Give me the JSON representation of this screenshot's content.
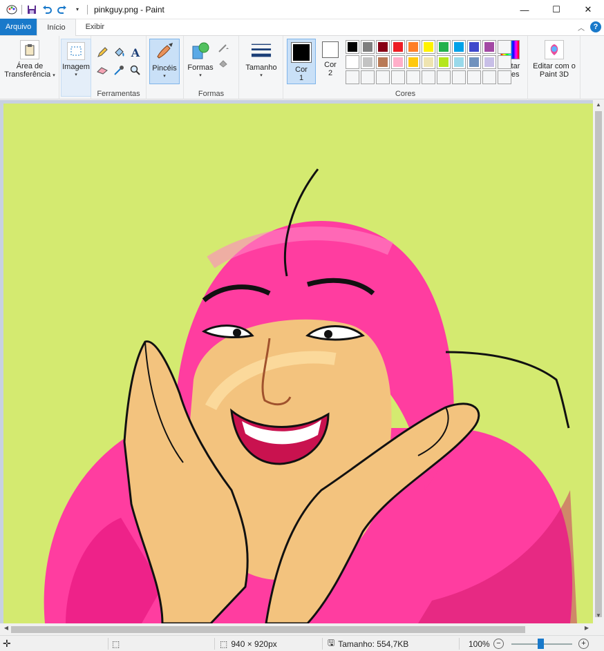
{
  "window": {
    "title": "pinkguy.png - Paint",
    "minimize": "—",
    "maximize": "☐",
    "close": "✕"
  },
  "tabs": [
    {
      "label": "Arquivo"
    },
    {
      "label": "Início"
    },
    {
      "label": "Exibir"
    }
  ],
  "ribbon": {
    "clipboard_label": "Área de Transferência",
    "image_label": "Imagem",
    "tools_group": "Ferramentas",
    "brushes_label": "Pincéis",
    "shapes_label": "Formas",
    "shapes_group": "Formas",
    "size_label": "Tamanho",
    "color1_label": "Cor 1",
    "color2_label": "Cor 2",
    "colors_group": "Cores",
    "edit_colors_label": "Editar cores",
    "paint3d_label": "Editar com o Paint 3D"
  },
  "palette": {
    "row1": [
      "#000000",
      "#7f7f7f",
      "#880015",
      "#ed1c24",
      "#ff7f27",
      "#fff200",
      "#22b14c",
      "#00a2e8",
      "#3f48cc",
      "#a349a4"
    ],
    "row2": [
      "#ffffff",
      "#c3c3c3",
      "#b97a57",
      "#ffaec9",
      "#ffc90e",
      "#efe4b0",
      "#b5e61d",
      "#99d9ea",
      "#7092be",
      "#c8bfe7"
    ],
    "primary": "#000000",
    "secondary": "#ffffff"
  },
  "canvas": {
    "background": "#d4ea70",
    "hood": "#ff3da0"
  },
  "status": {
    "dimensions": "940 × 920px",
    "size": "Tamanho: 554,7KB",
    "zoom": "100%",
    "zoom_minus": "−",
    "zoom_plus": "+"
  }
}
